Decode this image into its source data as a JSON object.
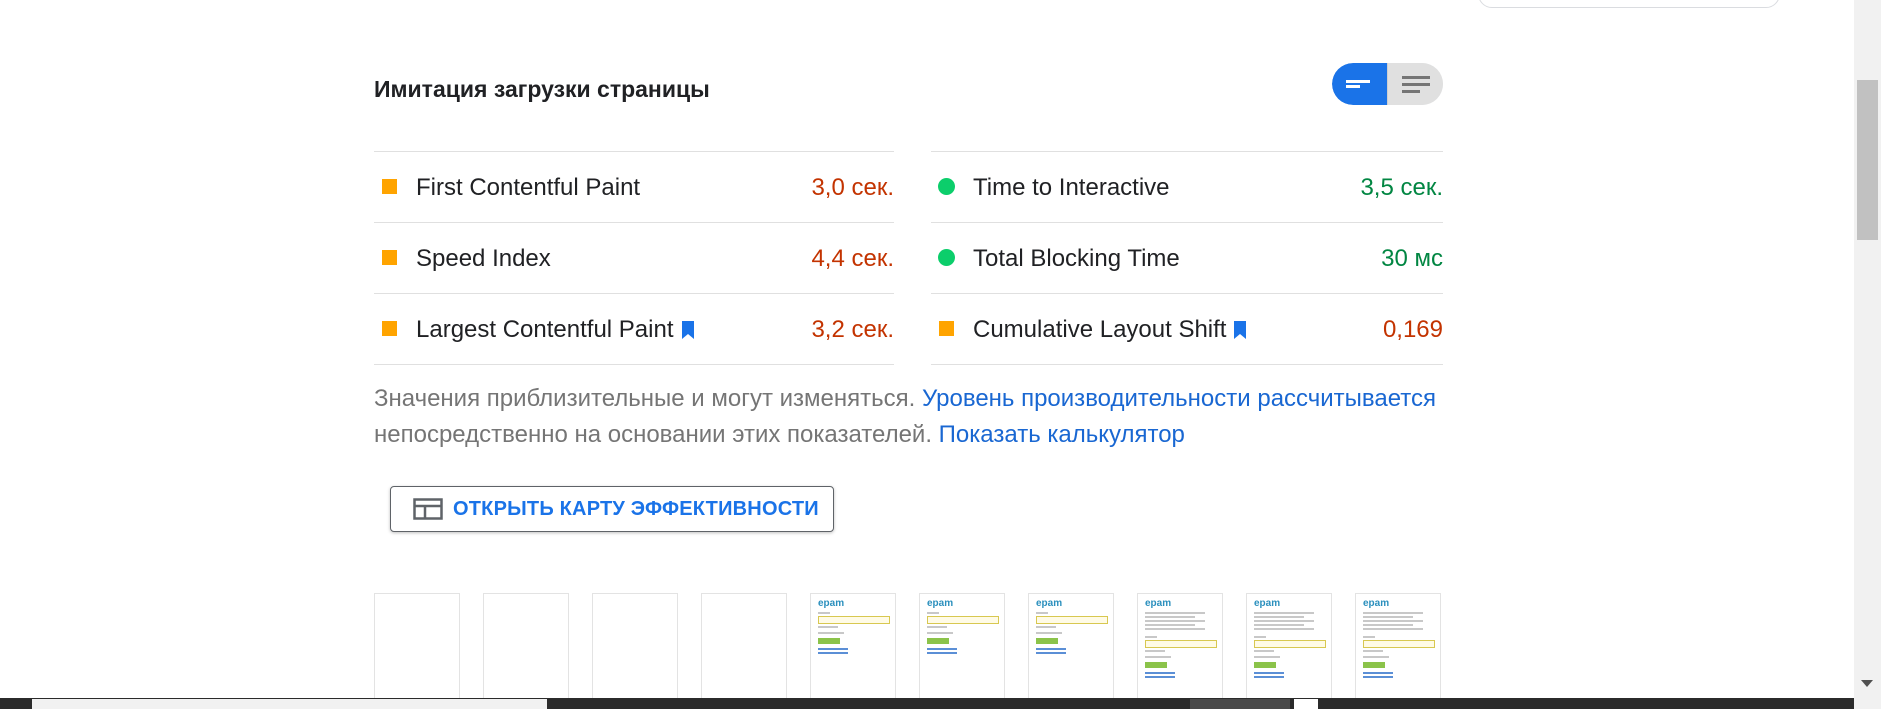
{
  "section": {
    "title": "Имитация загрузки страницы"
  },
  "metrics_left": [
    {
      "label": "First Contentful Paint",
      "value": "3,0 сек.",
      "status": "average",
      "icon": "orange-square-icon"
    },
    {
      "label": "Speed Index",
      "value": "4,4 сек.",
      "status": "average",
      "icon": "orange-square-icon"
    },
    {
      "label": "Largest Contentful Paint",
      "value": "3,2 сек.",
      "status": "average",
      "icon": "orange-square-icon",
      "bookmark": true
    }
  ],
  "metrics_right": [
    {
      "label": "Time to Interactive",
      "value": "3,5 сек.",
      "status": "good",
      "icon": "green-circle-icon"
    },
    {
      "label": "Total Blocking Time",
      "value": "30 мс",
      "status": "good",
      "icon": "green-circle-icon"
    },
    {
      "label": "Cumulative Layout Shift",
      "value": "0,169",
      "status": "average",
      "icon": "orange-square-icon",
      "bookmark": true
    }
  ],
  "note": {
    "text1": "Значения приблизительные и могут изменяться. ",
    "link1": "Уровень производительности рассчитывается",
    "text2": " непосредственно на основании этих показателей. ",
    "link2": "Показать калькулятор"
  },
  "treemap": {
    "button_label": "ОТКРЫТЬ КАРТУ ЭФФЕКТИВНОСТИ"
  },
  "filmstrip": {
    "logo_text": "epam",
    "frames": [
      "blank",
      "blank",
      "blank",
      "blank",
      "form",
      "form",
      "form",
      "form-text",
      "form-text",
      "form-text"
    ]
  },
  "colors": {
    "accent": "#1a73e8",
    "average": "#c33300",
    "good": "#018642",
    "average_icon": "#ffa400",
    "good_icon": "#0cce6b"
  }
}
